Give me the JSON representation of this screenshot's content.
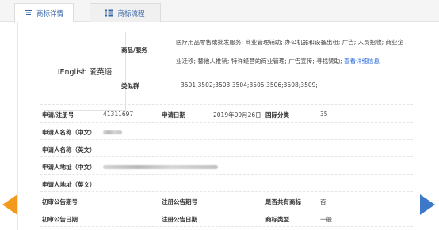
{
  "tabs": [
    {
      "label": "商标详情",
      "active": true
    },
    {
      "label": "商标流程",
      "active": false
    }
  ],
  "logo_text": "IEnglish 爱英语",
  "goods": {
    "label": "商品/服务",
    "text": "医疗用品零售或批发服务; 商业管理辅助; 办公机器和设备出租; 广告; 人员招收; 商业企业迁移; 替他人推销; 特许经营的商业管理; 广告宣传; 寻找赞助;",
    "link": "查看详细信息"
  },
  "similar": {
    "label": "类似群",
    "value": "3501;3502;3503;3504;3505;3506;3508;3509;"
  },
  "fields": {
    "reg_no_label": "申请/注册号",
    "reg_no": "41311697",
    "app_date_label": "申请日期",
    "app_date": "2019年09月26日",
    "intl_class_label": "国际分类",
    "intl_class": "35",
    "applicant_cn_label": "申请人名称（中文）",
    "applicant_en_label": "申请人名称（英文）",
    "address_cn_label": "申请人地址（中文）",
    "address_en_label": "申请人地址（英文）",
    "prelim_no_label": "初审公告期号",
    "reg_pub_no_label": "注册公告期号",
    "shared_label": "是否共有商标",
    "shared": "否",
    "prelim_date_label": "初审公告日期",
    "reg_pub_date_label": "注册公告日期",
    "type_label": "商标类型",
    "type": "一般"
  },
  "colors": {
    "tab_text": "#3a66a8",
    "link": "#2a6bd8",
    "prev_arrow": "#f39a1d",
    "next_arrow": "#3c79c8"
  },
  "icons": [
    "detail-list-icon",
    "flow-list-icon",
    "prev-arrow-icon",
    "next-arrow-icon"
  ]
}
